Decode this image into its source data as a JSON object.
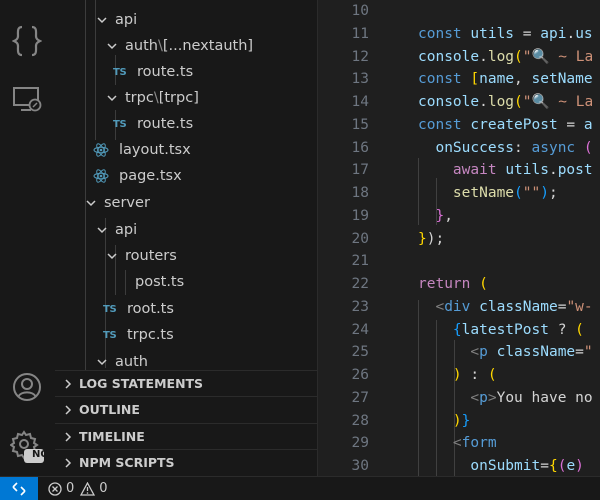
{
  "explorer": {
    "rows": [
      {
        "label": "api"
      },
      {
        "label_a": "auth",
        "sep": "\\",
        "label_b": "[...nextauth]"
      },
      {
        "badge": "TS",
        "label": "route.ts"
      },
      {
        "label_a": "trpc",
        "sep": "\\",
        "label_b": "[trpc]"
      },
      {
        "badge": "TS",
        "label": "route.ts"
      },
      {
        "label": "layout.tsx"
      },
      {
        "label": "page.tsx"
      },
      {
        "label": "server"
      },
      {
        "label": "api"
      },
      {
        "label": "routers"
      },
      {
        "badge": "TS",
        "label": "post.ts"
      },
      {
        "badge": "TS",
        "label": "root.ts"
      },
      {
        "badge": "TS",
        "label": "trpc.ts"
      },
      {
        "label": "auth"
      }
    ]
  },
  "sections": [
    {
      "label": "LOG STATEMENTS"
    },
    {
      "label": "OUTLINE"
    },
    {
      "label": "TIMELINE"
    },
    {
      "label": "NPM SCRIPTS"
    }
  ],
  "activity": {
    "icons": [
      "explorer-braces-icon",
      "remote-explorer-icon",
      "account-icon",
      "settings-gear-icon"
    ],
    "settings_badge": "NO"
  },
  "editor": {
    "line_numbers": [
      "10",
      "11",
      "12",
      "13",
      "14",
      "15",
      "16",
      "17",
      "18",
      "19",
      "20",
      "21",
      "22",
      "23",
      "24",
      "25",
      "26",
      "27",
      "28",
      "29",
      "30"
    ],
    "lines": [
      [],
      [
        {
          "t": "const ",
          "c": "kw"
        },
        {
          "t": "utils",
          "c": "var"
        },
        {
          "t": " = ",
          "c": "txt"
        },
        {
          "t": "api",
          "c": "var"
        },
        {
          "t": ".",
          "c": "txt"
        },
        {
          "t": "us",
          "c": "var"
        }
      ],
      [
        {
          "t": "console",
          "c": "var"
        },
        {
          "t": ".",
          "c": "txt"
        },
        {
          "t": "log",
          "c": "fn"
        },
        {
          "t": "(",
          "c": "brk1"
        },
        {
          "t": "\"🔍 ~ La",
          "c": "str"
        }
      ],
      [
        {
          "t": "const ",
          "c": "kw"
        },
        {
          "t": "[",
          "c": "brk1"
        },
        {
          "t": "name",
          "c": "var"
        },
        {
          "t": ", ",
          "c": "txt"
        },
        {
          "t": "setName",
          "c": "var"
        }
      ],
      [
        {
          "t": "console",
          "c": "var"
        },
        {
          "t": ".",
          "c": "txt"
        },
        {
          "t": "log",
          "c": "fn"
        },
        {
          "t": "(",
          "c": "brk1"
        },
        {
          "t": "\"🔍 ~ La",
          "c": "str"
        }
      ],
      [
        {
          "t": "const ",
          "c": "kw"
        },
        {
          "t": "createPost",
          "c": "var"
        },
        {
          "t": " = ",
          "c": "txt"
        },
        {
          "t": "a",
          "c": "var"
        }
      ],
      [
        {
          "t": "  onSuccess",
          "c": "var"
        },
        {
          "t": ": ",
          "c": "txt"
        },
        {
          "t": "async ",
          "c": "kw"
        },
        {
          "t": "(",
          "c": "brk2"
        }
      ],
      [
        {
          "t": "    ",
          "c": "txt"
        },
        {
          "t": "await ",
          "c": "ctl"
        },
        {
          "t": "utils",
          "c": "var"
        },
        {
          "t": ".",
          "c": "txt"
        },
        {
          "t": "post",
          "c": "var"
        }
      ],
      [
        {
          "t": "    ",
          "c": "txt"
        },
        {
          "t": "setName",
          "c": "fn"
        },
        {
          "t": "(",
          "c": "brk3"
        },
        {
          "t": "\"\"",
          "c": "str"
        },
        {
          "t": ")",
          "c": "brk3"
        },
        {
          "t": ";",
          "c": "txt"
        }
      ],
      [
        {
          "t": "  ",
          "c": "txt"
        },
        {
          "t": "}",
          "c": "brk2"
        },
        {
          "t": ",",
          "c": "txt"
        }
      ],
      [
        {
          "t": "}",
          "c": "brk1"
        },
        {
          "t": ");",
          "c": "txt"
        }
      ],
      [],
      [
        {
          "t": "return ",
          "c": "ctl"
        },
        {
          "t": "(",
          "c": "brk1"
        }
      ],
      [
        {
          "t": "  ",
          "c": "txt"
        },
        {
          "t": "<",
          "c": "punc"
        },
        {
          "t": "div ",
          "c": "tag"
        },
        {
          "t": "className",
          "c": "var"
        },
        {
          "t": "=",
          "c": "txt"
        },
        {
          "t": "\"w-",
          "c": "str"
        }
      ],
      [
        {
          "t": "    ",
          "c": "txt"
        },
        {
          "t": "{",
          "c": "brk3"
        },
        {
          "t": "latestPost",
          "c": "var"
        },
        {
          "t": " ? ",
          "c": "txt"
        },
        {
          "t": "(",
          "c": "brk1"
        }
      ],
      [
        {
          "t": "      ",
          "c": "txt"
        },
        {
          "t": "<",
          "c": "punc"
        },
        {
          "t": "p ",
          "c": "tag"
        },
        {
          "t": "className",
          "c": "var"
        },
        {
          "t": "=",
          "c": "txt"
        },
        {
          "t": "\"",
          "c": "str"
        }
      ],
      [
        {
          "t": "    ",
          "c": "txt"
        },
        {
          "t": ")",
          "c": "brk1"
        },
        {
          "t": " : ",
          "c": "txt"
        },
        {
          "t": "(",
          "c": "brk1"
        }
      ],
      [
        {
          "t": "      ",
          "c": "txt"
        },
        {
          "t": "<",
          "c": "punc"
        },
        {
          "t": "p",
          "c": "tag"
        },
        {
          "t": ">",
          "c": "punc"
        },
        {
          "t": "You have no",
          "c": "txt"
        }
      ],
      [
        {
          "t": "    ",
          "c": "txt"
        },
        {
          "t": ")",
          "c": "brk1"
        },
        {
          "t": "}",
          "c": "brk3"
        }
      ],
      [
        {
          "t": "    ",
          "c": "txt"
        },
        {
          "t": "<",
          "c": "punc"
        },
        {
          "t": "form",
          "c": "tag"
        }
      ],
      [
        {
          "t": "      ",
          "c": "txt"
        },
        {
          "t": "onSubmit",
          "c": "var"
        },
        {
          "t": "=",
          "c": "txt"
        },
        {
          "t": "{",
          "c": "brk1"
        },
        {
          "t": "(",
          "c": "brk2"
        },
        {
          "t": "e",
          "c": "var"
        },
        {
          "t": ")",
          "c": "brk2"
        }
      ]
    ]
  },
  "status": {
    "errors": "0",
    "warnings": "0"
  }
}
